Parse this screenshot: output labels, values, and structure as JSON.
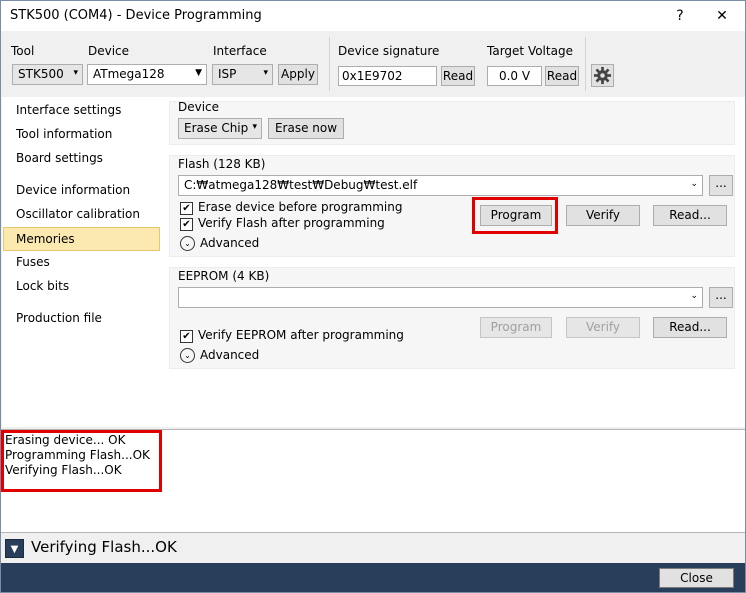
{
  "window": {
    "title": "STK500 (COM4) - Device Programming",
    "help_glyph": "?",
    "close_glyph": "✕"
  },
  "toolbar": {
    "tool_label": "Tool",
    "tool_value": "STK500",
    "device_label": "Device",
    "device_value": "ATmega128",
    "interface_label": "Interface",
    "interface_value": "ISP",
    "apply_label": "Apply",
    "signature_label": "Device signature",
    "signature_value": "0x1E9702",
    "signature_read_label": "Read",
    "voltage_label": "Target Voltage",
    "voltage_value": "0.0 V",
    "voltage_read_label": "Read",
    "settings_icon": "gear-icon"
  },
  "sidebar": {
    "items": [
      {
        "label": "Interface settings"
      },
      {
        "label": "Tool information"
      },
      {
        "label": "Board settings"
      },
      {
        "label": "Device information"
      },
      {
        "label": "Oscillator calibration"
      },
      {
        "label": "Memories"
      },
      {
        "label": "Fuses"
      },
      {
        "label": "Lock bits"
      },
      {
        "label": "Production file"
      }
    ],
    "selected": "Memories",
    "selected_bg": "#fbe9b0"
  },
  "device_section": {
    "title": "Device",
    "erase_mode": "Erase Chip",
    "erase_now_label": "Erase now"
  },
  "flash": {
    "title": "Flash (128 KB)",
    "file_path": "C:₩atmega128₩test₩Debug₩test.elf",
    "browse_label": "...",
    "erase_before_label": "Erase device before programming",
    "erase_before_checked": true,
    "verify_after_label": "Verify Flash after programming",
    "verify_after_checked": true,
    "advanced_label": "Advanced",
    "program_label": "Program",
    "verify_label": "Verify",
    "read_label": "Read..."
  },
  "eeprom": {
    "title": "EEPROM (4 KB)",
    "file_path": "",
    "browse_label": "...",
    "verify_after_label": "Verify EEPROM after programming",
    "verify_after_checked": true,
    "advanced_label": "Advanced",
    "program_label": "Program",
    "verify_label": "Verify",
    "read_label": "Read..."
  },
  "log": {
    "lines": [
      "Erasing device... OK",
      "Programming Flash...OK",
      "Verifying Flash...OK"
    ]
  },
  "status": {
    "expand_glyph": "▼",
    "text": "Verifying Flash...OK"
  },
  "footer": {
    "close_label": "Close"
  },
  "colors": {
    "highlight": "#e00000",
    "footer_bg": "#283e5a",
    "selection": "#fbe9b0"
  }
}
